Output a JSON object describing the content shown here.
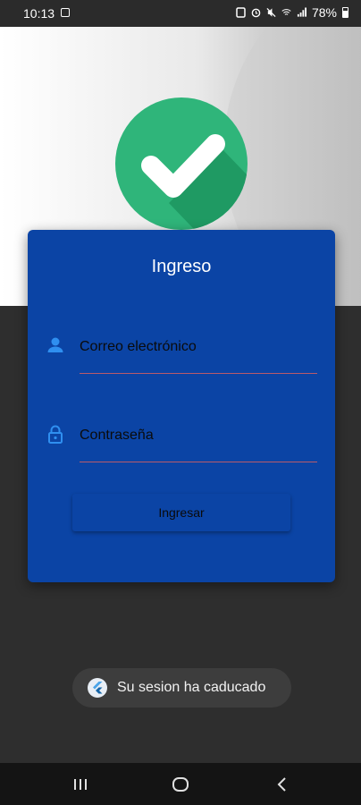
{
  "status_bar": {
    "time": "10:13",
    "battery": "78%"
  },
  "login": {
    "title": "Ingreso",
    "email_placeholder": "Correo electrónico",
    "password_placeholder": "Contraseña",
    "submit_label": "Ingresar"
  },
  "toast": {
    "message": "Su sesion ha caducado"
  },
  "colors": {
    "card_background": "#0b44a5",
    "accent_green": "#2fb57a",
    "field_icon": "#2f8ff0",
    "underline": "#b85a6a"
  },
  "icons": {
    "logo": "check-badge-icon",
    "email": "person-icon",
    "password": "lock-icon",
    "toast": "flutter-icon"
  }
}
